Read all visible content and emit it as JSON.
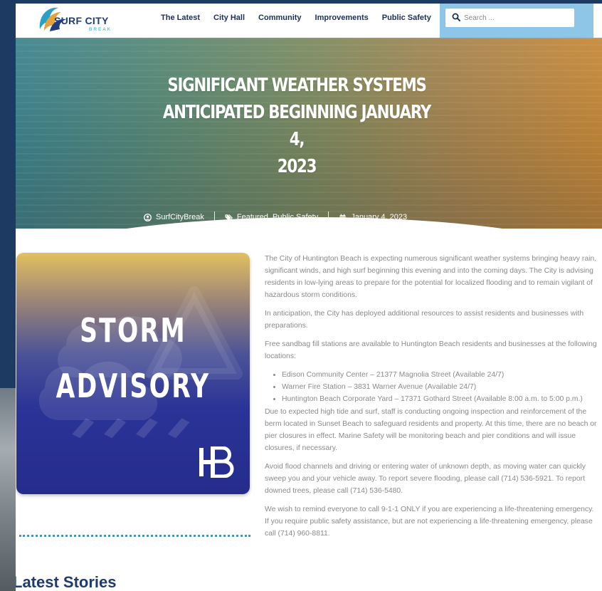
{
  "header": {
    "logo_text": "SURF CITY",
    "logo_sub": "BREAK",
    "nav": [
      "The Latest",
      "City Hall",
      "Community",
      "Improvements",
      "Public Safety"
    ],
    "search_placeholder": "Search ..."
  },
  "hero": {
    "title_lines": [
      "SIGNIFICANT WEATHER SYSTEMS",
      "ANTICIPATED BEGINNING JANUARY 4,",
      "2023"
    ],
    "author": "SurfCityBreak",
    "categories": "Featured, Public Safety",
    "date": "January 4, 2023"
  },
  "image": {
    "line1": "STORM",
    "line2": "ADVISORY"
  },
  "sidebar": {
    "latest_stories": "Latest Stories"
  },
  "article": {
    "p1": "The City of Huntington Beach is expecting numerous significant weather systems bringing heavy rain, significant winds, and high surf beginning this evening and into the coming days. The City is advising residents in low-lying areas to prepare for the potential for localized flooding and to remain vigilant of hazardous storm conditions.",
    "p2": "In anticipation, the City has deployed additional resources to assist residents and businesses with preparations.",
    "p3": "Free sandbag fill stations are available to Huntington Beach residents and businesses at the following locations:",
    "list": [
      "Edison Community Center – 21377 Magnolia Street (Available 24/7)",
      "Warner Fire Station – 3831 Warner Avenue (Available 24/7)",
      "Huntington Beach Corporate Yard – 17371 Gothard Street (Available 8:00 a.m. to 5:00 p.m.)"
    ],
    "p4": "Due to expected high tide and surf, staff is conducting ongoing inspection and reinforcement of the berm located in Sunset Beach to safeguard residents and property. At this time, there are no beach or pier closures in effect. Marine Safety will be monitoring beach and pier conditions and will issue closures, if necessary.",
    "p5": "Avoid flood channels and driving or entering water of unknown depth, as moving water can quickly sweep you and your vehicle away. To report severe flooding, please call (714) 536-5921. To report downed trees, please call (714) 536-5480.",
    "p6": "We wish to remind everyone to call 9-1-1 ONLY if you are experiencing a life-threatening emergency. If you require public safety assistance, but are not experiencing a life-threatening emergency, please call (714) 960-8811."
  },
  "colors": {
    "nav_text": "#1e2f55",
    "search_bar_bg": "#8dc6e6",
    "accent_teal": "#2aa0c9",
    "heading_blue": "#1e3a6e"
  },
  "icons": [
    "surf-city-wave-logo",
    "search-icon",
    "user-circle-icon",
    "tags-icon",
    "calendar-icon",
    "hb-logo"
  ]
}
